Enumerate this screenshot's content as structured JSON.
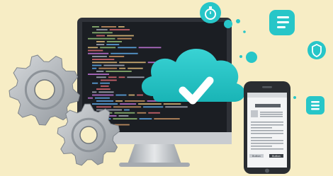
{
  "colors": {
    "background": "#f7edc5",
    "accent": "#27c6c8",
    "accent_dark": "#1aa7a9",
    "monitor_frame": "#2f3238",
    "screen": "#1b1e23",
    "gear": "#a9aeb4",
    "phone": "#2a2d31"
  },
  "icons": {
    "cloud": "cloud-check-icon",
    "gears": "gear-icon",
    "floating": [
      "stopwatch-icon",
      "list-icon",
      "shield-icon",
      "list-icon"
    ]
  },
  "phone": {
    "buttons": [
      "Button",
      "Button"
    ]
  }
}
